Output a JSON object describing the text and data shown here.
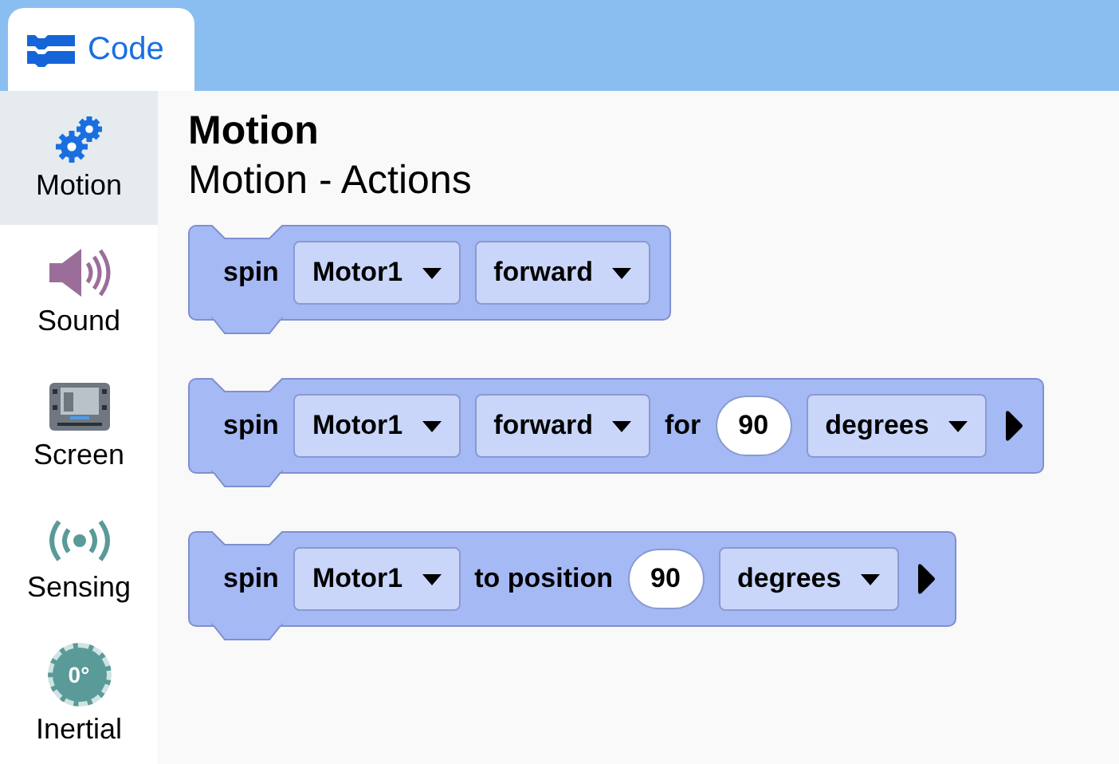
{
  "tabs": [
    {
      "label": "Code",
      "selected": true
    }
  ],
  "sidebar": {
    "items": [
      {
        "label": "Motion",
        "kind": "gears",
        "selected": true
      },
      {
        "label": "Sound",
        "kind": "speaker",
        "selected": false
      },
      {
        "label": "Screen",
        "kind": "screen",
        "selected": false
      },
      {
        "label": "Sensing",
        "kind": "signal",
        "selected": false
      },
      {
        "label": "Inertial",
        "kind": "dial",
        "icon_text": "0°",
        "selected": false
      }
    ]
  },
  "heading": "Motion",
  "subheading": "Motion - Actions",
  "blocks": [
    {
      "parts": [
        {
          "kind": "label",
          "text": "spin"
        },
        {
          "kind": "dropdown",
          "text": "Motor1"
        },
        {
          "kind": "dropdown",
          "text": "forward"
        }
      ]
    },
    {
      "parts": [
        {
          "kind": "label",
          "text": "spin"
        },
        {
          "kind": "dropdown",
          "text": "Motor1"
        },
        {
          "kind": "dropdown",
          "text": "forward"
        },
        {
          "kind": "label",
          "text": "for"
        },
        {
          "kind": "number",
          "text": "90"
        },
        {
          "kind": "dropdown",
          "text": "degrees"
        },
        {
          "kind": "expand"
        }
      ]
    },
    {
      "parts": [
        {
          "kind": "label",
          "text": "spin"
        },
        {
          "kind": "dropdown",
          "text": "Motor1"
        },
        {
          "kind": "label",
          "text": "to position"
        },
        {
          "kind": "number",
          "text": "90"
        },
        {
          "kind": "dropdown",
          "text": "degrees"
        },
        {
          "kind": "expand"
        }
      ]
    }
  ]
}
